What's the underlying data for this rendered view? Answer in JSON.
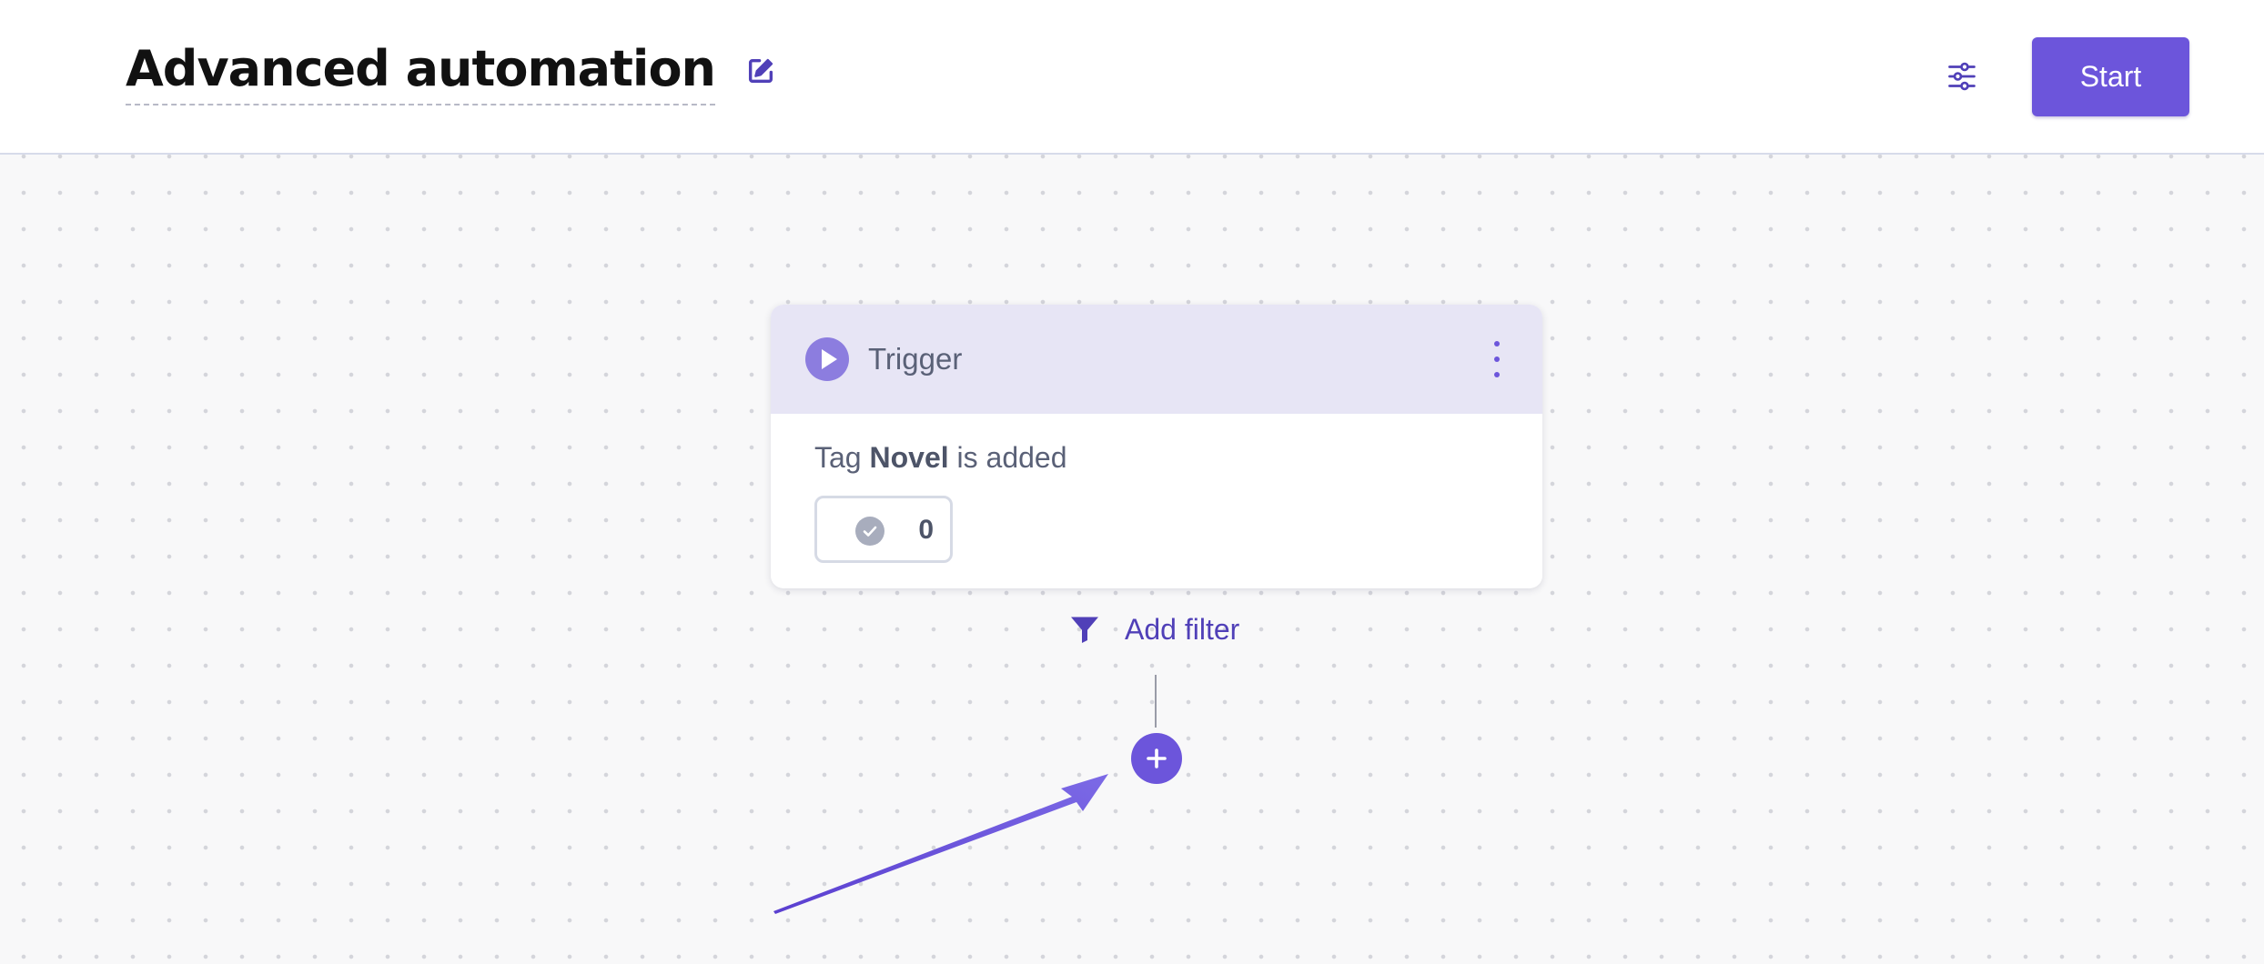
{
  "header": {
    "title": "Advanced automation",
    "start_label": "Start"
  },
  "trigger_card": {
    "title": "Trigger",
    "description_prefix": "Tag",
    "tag_name": "Novel",
    "description_suffix": "is added",
    "completed_count": "0"
  },
  "flow": {
    "add_filter_label": "Add filter"
  },
  "icons": {
    "edit": "edit-icon",
    "settings": "sliders-icon",
    "trigger": "play-icon",
    "more": "more-vertical-icon",
    "completed": "check-circle-icon",
    "filter": "filter-icon",
    "add_step": "plus-icon"
  },
  "colors": {
    "accent": "#6c55db",
    "accent_text": "#5040b8",
    "card_header_bg": "#e7e5f5",
    "canvas_bg": "#f8f8f9",
    "text_muted": "#5a6177"
  }
}
